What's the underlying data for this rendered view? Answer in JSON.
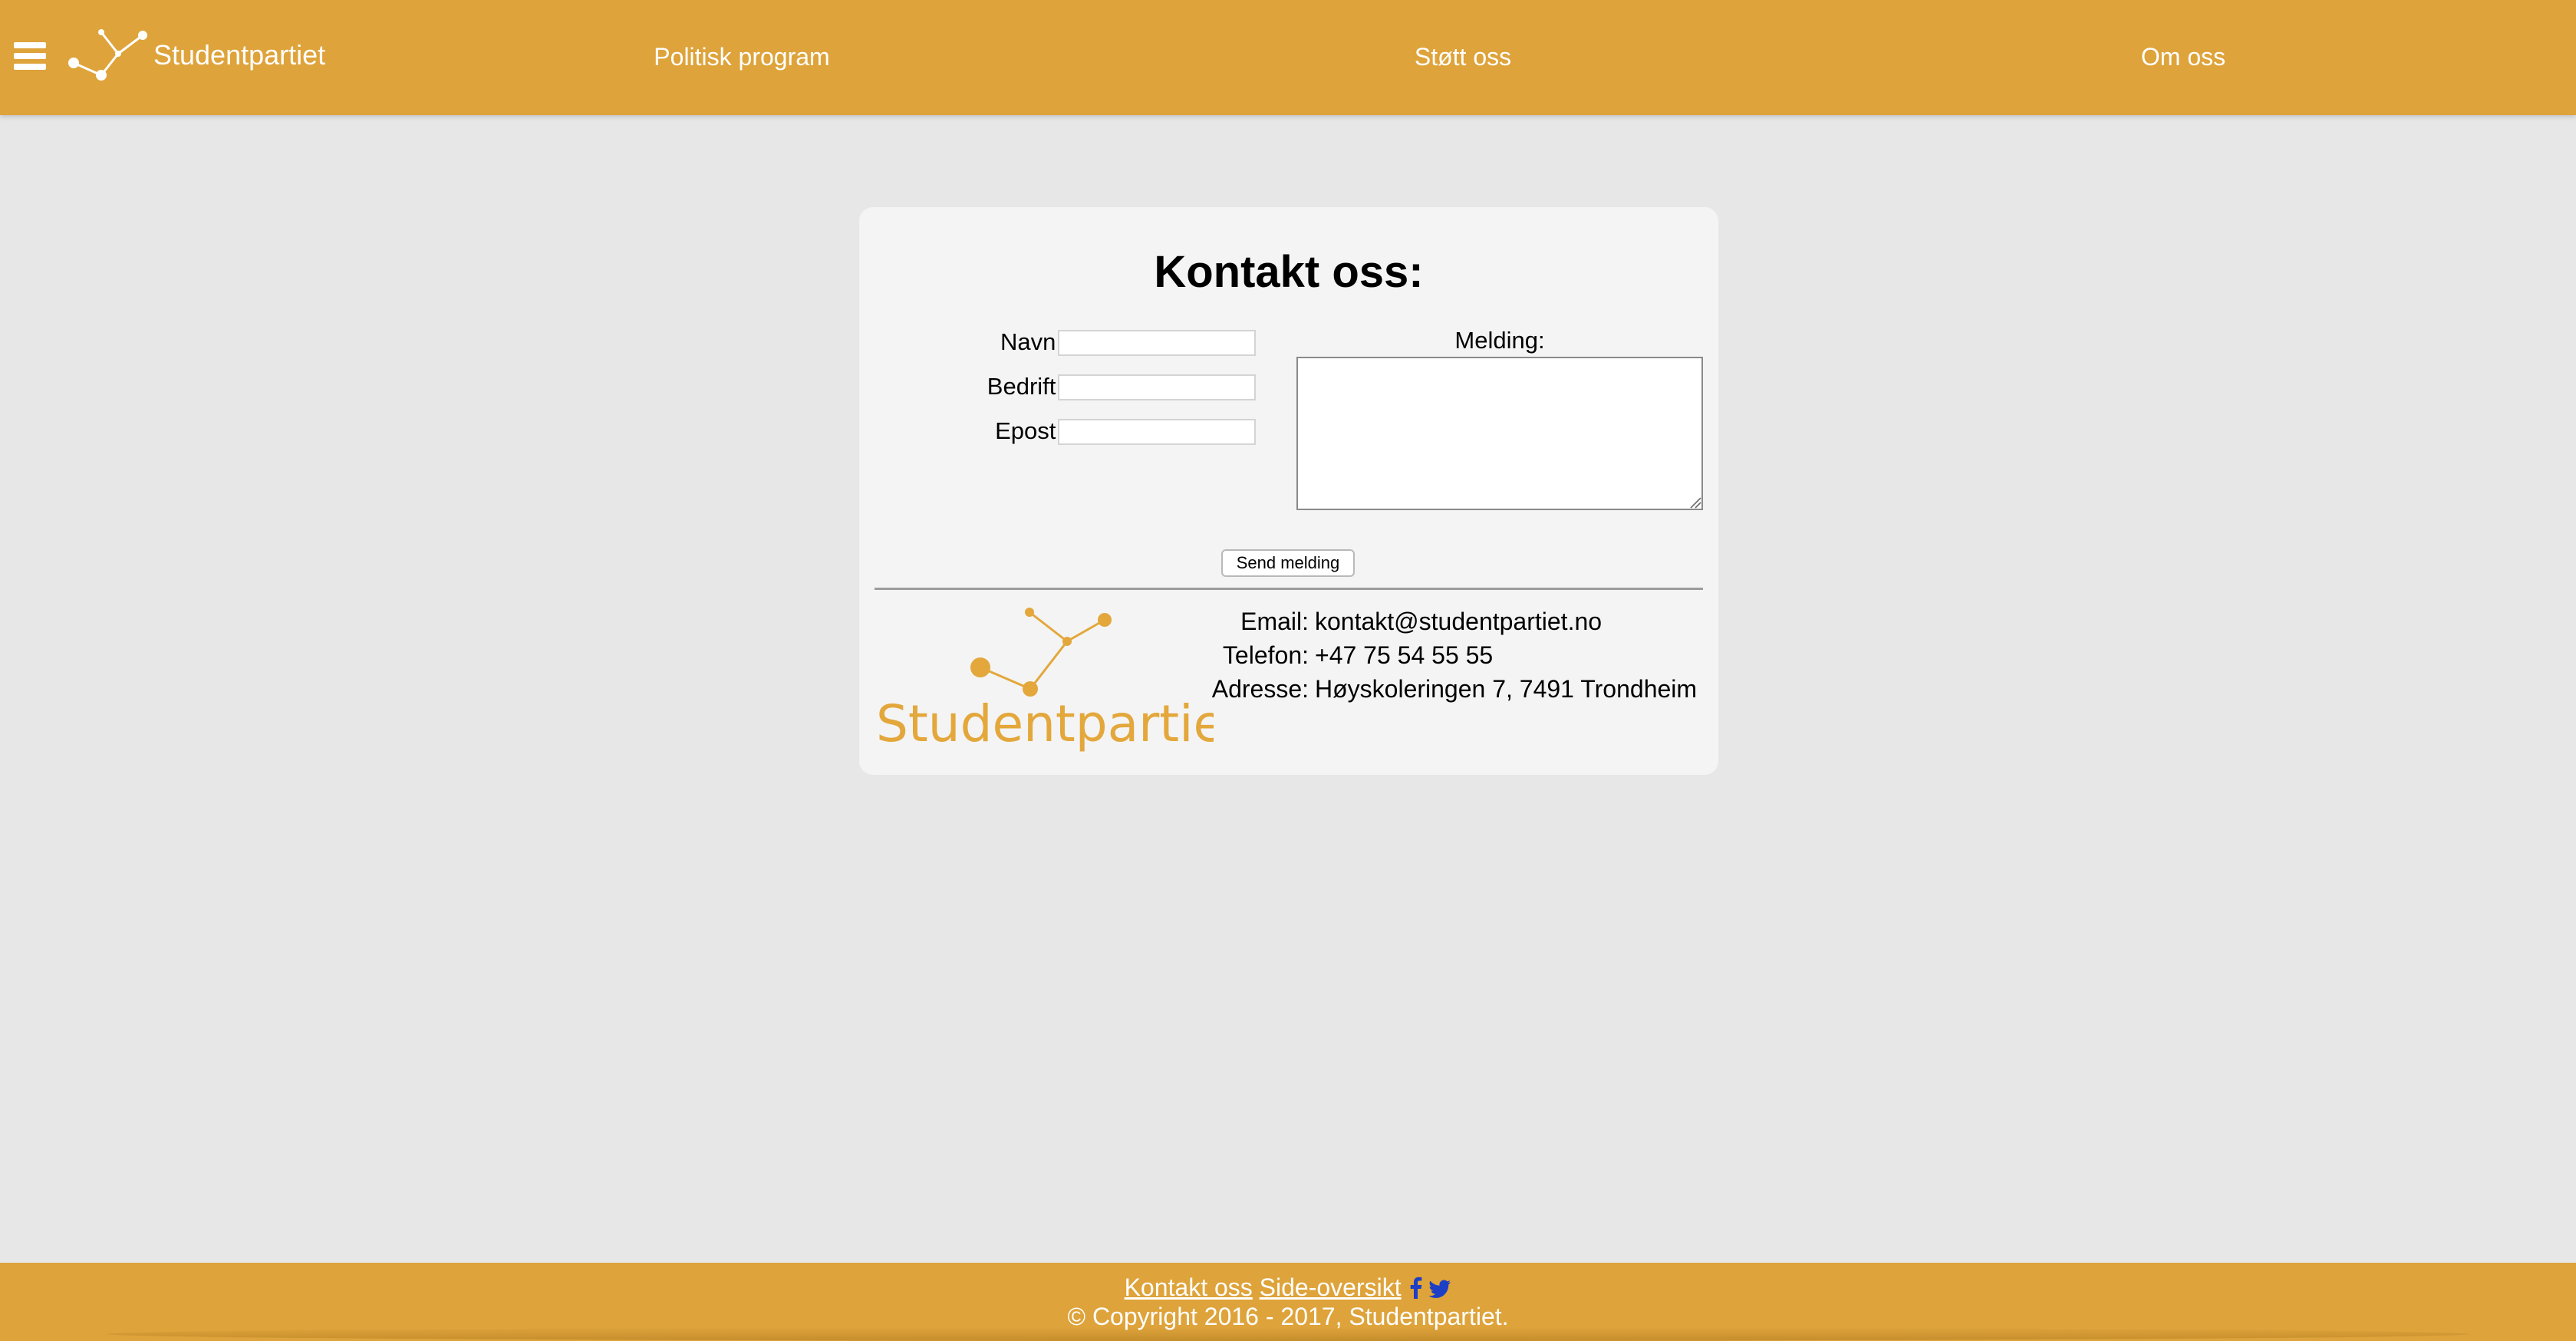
{
  "header": {
    "brand_name": "Studentpartiet",
    "menu_icon": "hamburger-menu-icon",
    "logo_icon": "constellation-logo-icon",
    "nav": [
      {
        "label": "Politisk program"
      },
      {
        "label": "Støtt oss"
      },
      {
        "label": "Om oss"
      }
    ],
    "background_color": "#dea33a"
  },
  "contact_form": {
    "title": "Kontakt oss:",
    "fields": [
      {
        "label": "Navn:",
        "value": ""
      },
      {
        "label": "Bedrift:",
        "value": ""
      },
      {
        "label": "Epost:",
        "value": ""
      }
    ],
    "message_label": "Melding:",
    "message_value": "",
    "submit_label": "Send melding"
  },
  "contact_info": {
    "logo_text": "Studentpartiet",
    "email_label": "Email:",
    "email": "kontakt@studentpartiet.no",
    "phone_label": "Telefon:",
    "phone": "+47 75 54 55 55",
    "address_label": "Adresse:",
    "address": "Høyskoleringen 7, 7491 Trondheim",
    "accent_color": "#e3a73b"
  },
  "footer": {
    "link_contact": "Kontakt oss",
    "link_sitemap": "Side-oversikt",
    "social_icons": [
      "facebook-icon",
      "twitter-icon"
    ],
    "copyright": "© Copyright 2016 - 2017, Studentpartiet."
  }
}
